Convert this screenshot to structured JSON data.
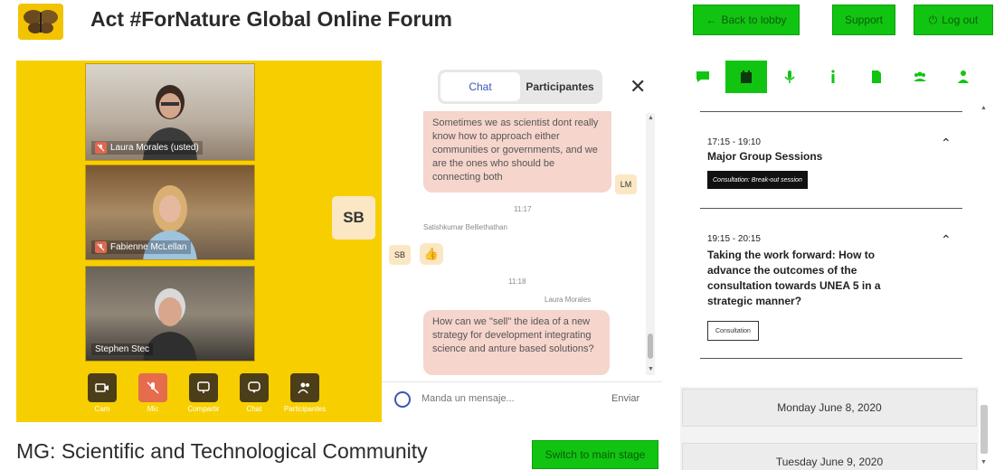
{
  "header": {
    "title": "Act #ForNature Global Online Forum",
    "back_label": "Back to lobby",
    "support_label": "Support",
    "logout_label": "Log out"
  },
  "video": {
    "participants": [
      {
        "name": "Laura Morales (usted)"
      },
      {
        "name": "Fabienne McLellan"
      },
      {
        "name": "Stephen Stec"
      }
    ],
    "speaker_initials": "SB",
    "controls": [
      {
        "label": "Cam",
        "icon": "camera-icon"
      },
      {
        "label": "Mic",
        "icon": "mic-muted-icon"
      },
      {
        "label": "Compartir",
        "icon": "screen-share-icon"
      },
      {
        "label": "Chat",
        "icon": "chat-icon"
      },
      {
        "label": "Participantes",
        "icon": "people-icon"
      }
    ]
  },
  "chat": {
    "tab_chat": "Chat",
    "tab_participants": "Participantes",
    "messages": [
      {
        "text": "Sometimes we as scientist dont really know how to approach either communities or governments, and we are the ones who should be connecting both",
        "initials": "LM"
      },
      {
        "time": "11:17",
        "sender": "Satishkumar Belliethathan",
        "initials": "SB",
        "text": "👍"
      },
      {
        "time": "11:18",
        "sender": "Laura Morales",
        "text": "How can we \"sell\" the idea of a new strategy for development integrating science and anture based solutions?"
      }
    ],
    "input_placeholder": "Manda un mensaje...",
    "send_label": "Enviar"
  },
  "stage": {
    "title": "MG: Scientific and Technological Community",
    "switch_label": "Switch to main stage"
  },
  "schedule": {
    "sessions": [
      {
        "time": "17:15 - 19:10",
        "title": "Major Group Sessions",
        "tag": "Consultation: Break-out session"
      },
      {
        "time": "19:15 - 20:15",
        "title": "Taking the work forward: How to advance the outcomes of the consultation towards UNEA 5 in a strategic manner?",
        "tag": "Consultation"
      }
    ],
    "days": [
      "Monday June 8, 2020",
      "Tuesday June 9, 2020"
    ]
  },
  "colors": {
    "accent_green": "#11c411",
    "video_bg": "#f7cf00",
    "bubble": "#f6d5cc"
  }
}
